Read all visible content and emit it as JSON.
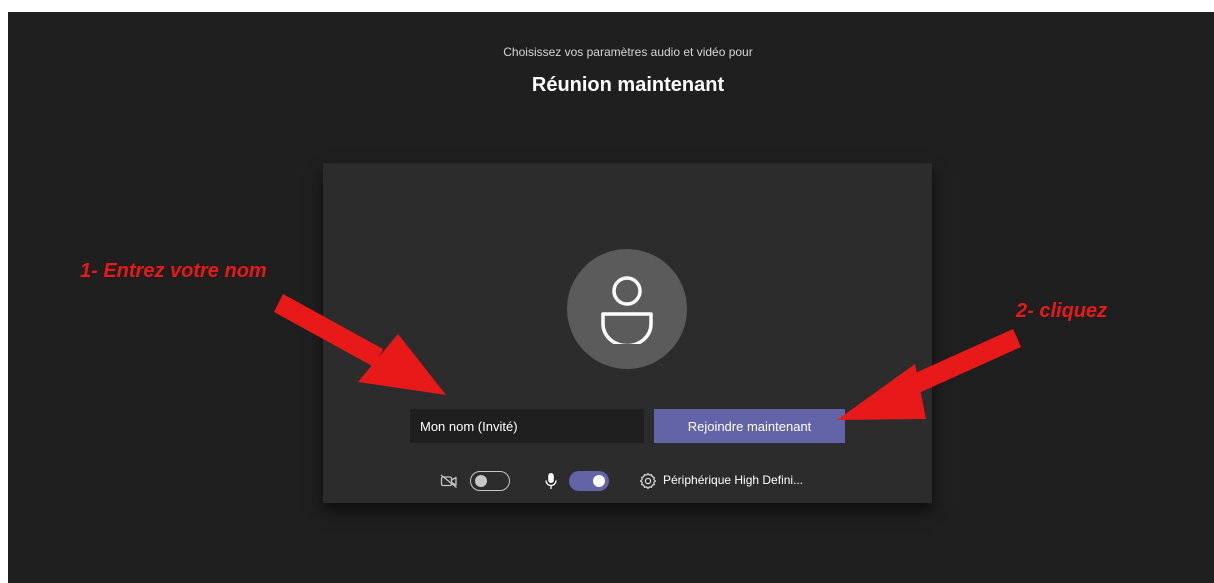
{
  "header": {
    "subtitle": "Choisissez vos paramètres audio et vidéo pour",
    "title": "Réunion maintenant"
  },
  "join_form": {
    "name_placeholder": "Mon nom (Invité)",
    "join_button_label": "Rejoindre maintenant"
  },
  "controls": {
    "camera_toggle": {
      "icon": "camera-off-icon",
      "state": "off"
    },
    "mic_toggle": {
      "icon": "microphone-icon",
      "state": "on"
    },
    "device": {
      "icon": "gear-icon",
      "label": "Périphérique High Defini..."
    }
  },
  "annotations": {
    "step1": "1- Entrez votre nom",
    "step2": "2- cliquez"
  },
  "colors": {
    "background": "#1f1f1f",
    "panel": "#2d2c2c",
    "accent": "#6264a7",
    "annotation": "#e81919"
  }
}
